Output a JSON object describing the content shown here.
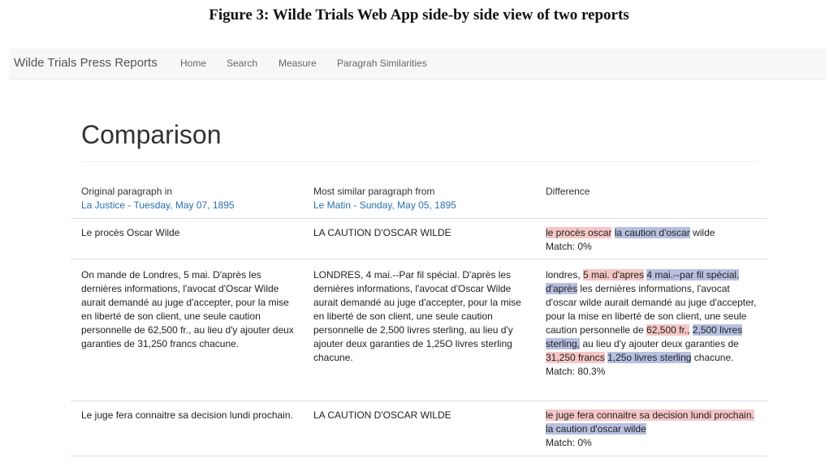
{
  "figure_caption": "Figure 3: Wilde Trials Web App side-by side view of two reports",
  "navbar": {
    "brand": "Wilde Trials Press Reports",
    "links": [
      "Home",
      "Search",
      "Measure",
      "Paragrah Similarities"
    ]
  },
  "page_title": "Comparison",
  "headers": {
    "original_label": "Original paragraph in",
    "original_source": "La Justice - Tuesday, May 07, 1895",
    "similar_label": "Most similar paragraph from",
    "similar_source": "Le Matin - Sunday, May 05, 1895",
    "difference_label": "Difference"
  },
  "colors": {
    "removed": "#f6c6c6",
    "added": "#b8c0e0",
    "link": "#2a6fb0"
  },
  "rows": [
    {
      "original": "Le procès Oscar Wilde",
      "similar": "LA CAUTION D'OSCAR WILDE",
      "diff": [
        {
          "t": "le procès oscar",
          "k": "rm"
        },
        {
          "t": " ",
          "k": ""
        },
        {
          "t": "la caution d'oscar",
          "k": "ad"
        },
        {
          "t": " wilde",
          "k": ""
        }
      ],
      "match": "Match: 0%"
    },
    {
      "original": "On mande de Londres, 5 mai. D'après les dernières informations, l'avocat d'Oscar Wilde aurait demandé au juge d'accepter, pour la mise en liberté de son client, une seule caution personnelle de 62,500 fr., au lieu d'y ajouter deux garanties de 31,250 francs chacune.",
      "similar": "LONDRES, 4 mai.--Par fil spécial. D'après les dernières informations, l'avocat d'Oscar Wilde aurait demandé au juge d'accepter, pour la mise en liberté de son client, une seule caution personnelle de 2,500 livres sterling, au lieu d'y ajouter deux garanties de 1,25O livres sterling chacune.",
      "diff": [
        {
          "t": "londres, ",
          "k": ""
        },
        {
          "t": "5 mai. d'apres",
          "k": "rm"
        },
        {
          "t": " ",
          "k": ""
        },
        {
          "t": "4 mai.--par fil spécial. d'après",
          "k": "ad"
        },
        {
          "t": " les dernières informations, l'avocat d'oscar wilde aurait demandé au juge d'accepter, pour la mise en liberté de son client, une seule caution personnelle de ",
          "k": ""
        },
        {
          "t": "62,500 fr.,",
          "k": "rm"
        },
        {
          "t": " ",
          "k": ""
        },
        {
          "t": "2,500 livres sterling,",
          "k": "ad"
        },
        {
          "t": " au lieu d'y ajouter deux garanties de ",
          "k": ""
        },
        {
          "t": "31,250 francs",
          "k": "rm"
        },
        {
          "t": " ",
          "k": ""
        },
        {
          "t": "1,25o livres sterling",
          "k": "ad"
        },
        {
          "t": " chacune.",
          "k": ""
        }
      ],
      "match": "Match: 80.3%"
    },
    {
      "original": "Le juge fera connaitre sa decision lundi prochain.",
      "similar": "LA CAUTION D'OSCAR WILDE",
      "diff": [
        {
          "t": "le juge fera connaitre sa decision lundi prochain.",
          "k": "rm"
        },
        {
          "t": " ",
          "k": ""
        },
        {
          "t": "la caution d'oscar wilde",
          "k": "ad"
        }
      ],
      "match": "Match: 0%"
    }
  ]
}
